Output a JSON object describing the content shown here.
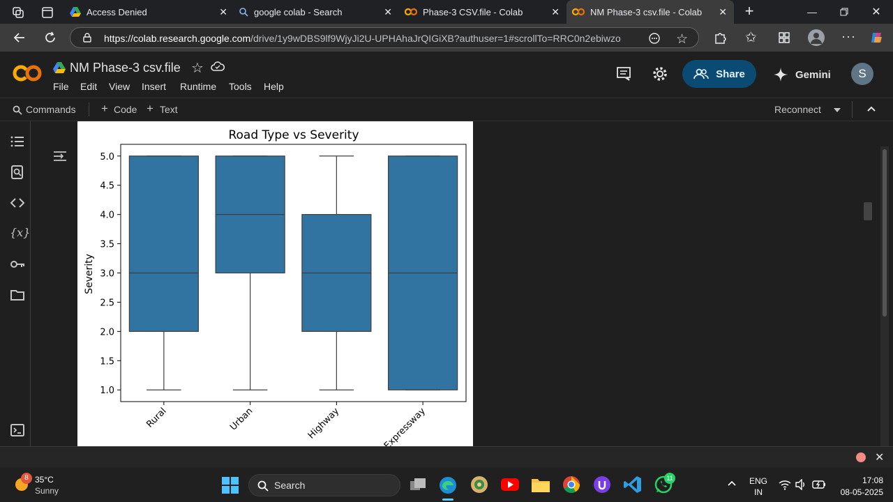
{
  "browser": {
    "tabs": [
      {
        "title": "Access Denied",
        "active": false
      },
      {
        "title": "google colab - Search",
        "active": false
      },
      {
        "title": "Phase-3 CSV.file - Colab",
        "active": false
      },
      {
        "title": "NM Phase-3 csv.file - Colab",
        "active": true
      }
    ],
    "url_domain": "https://colab.research.google.com",
    "url_path": "/drive/1y9wDBS9lf9WjyJi2U-UPHAhaJrQIGiXB?authuser=1#scrollTo=RRC0n2ebiwzo"
  },
  "colab": {
    "notebook_title": "NM Phase-3 csv.file",
    "menu": [
      "File",
      "Edit",
      "View",
      "Insert",
      "Runtime",
      "Tools",
      "Help"
    ],
    "share_label": "Share",
    "gemini_label": "Gemini",
    "avatar_letter": "S",
    "toolbar": {
      "commands": "Commands",
      "code": "Code",
      "text": "Text",
      "reconnect": "Reconnect"
    }
  },
  "chart_data": {
    "type": "box",
    "title": "Road Type vs Severity",
    "xlabel": "",
    "ylabel": "Severity",
    "ylim": [
      0.8,
      5.2
    ],
    "yticks": [
      1.0,
      1.5,
      2.0,
      2.5,
      3.0,
      3.5,
      4.0,
      4.5,
      5.0
    ],
    "ytick_labels": [
      "1.0",
      "1.5",
      "2.0",
      "2.5",
      "3.0",
      "3.5",
      "4.0",
      "4.5",
      "5.0"
    ],
    "categories": [
      "Rural",
      "Urban",
      "Highway",
      "Expressway"
    ],
    "boxes": [
      {
        "whislo": 1,
        "q1": 2,
        "med": 3,
        "q3": 5,
        "whishi": 5
      },
      {
        "whislo": 1,
        "q1": 3,
        "med": 4,
        "q3": 5,
        "whishi": 5
      },
      {
        "whislo": 1,
        "q1": 2,
        "med": 3,
        "q3": 4,
        "whishi": 5
      },
      {
        "whislo": 1,
        "q1": 1,
        "med": 3,
        "q3": 5,
        "whishi": 5
      }
    ],
    "color": "#3274a1",
    "grid": false
  },
  "taskbar": {
    "weather_temp": "35°C",
    "weather_desc": "Sunny",
    "weather_badge": "8",
    "search_label": "Search",
    "whatsapp_badge": "11",
    "lang_top": "ENG",
    "lang_bottom": "IN",
    "time": "17:08",
    "date": "08-05-2025"
  }
}
